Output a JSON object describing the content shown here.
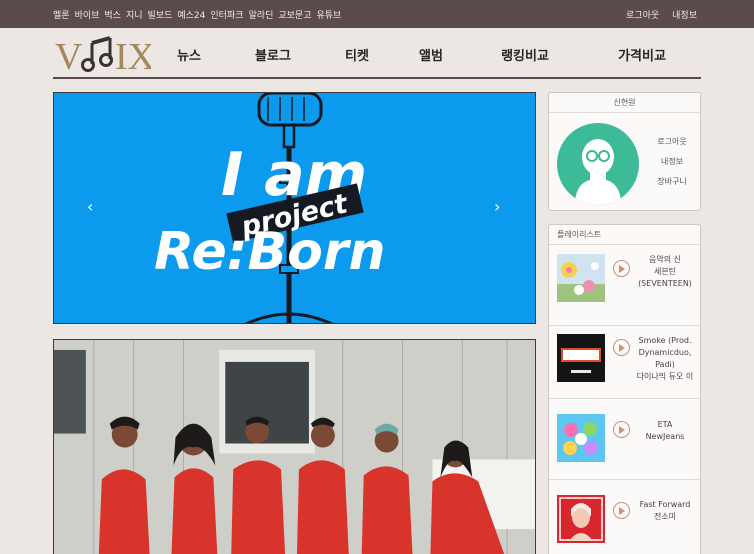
{
  "topbar": {
    "links": [
      "멜론",
      "바이브",
      "벅스",
      "지니",
      "빌보드",
      "예스24",
      "인터파크",
      "알라딘",
      "교보문고",
      "유튜브"
    ],
    "logout": "로그아웃",
    "myinfo": "내정보"
  },
  "logo": {
    "left": "V",
    "right": "IX"
  },
  "nav": [
    "뉴스",
    "블로그",
    "티켓",
    "앨범",
    "랭킹비교",
    "가격비교"
  ],
  "banner": {
    "line1": "I am",
    "line2": "project",
    "line3": "Re:Born",
    "prev": "‹",
    "next": "›",
    "background": "#0b9aee"
  },
  "profile": {
    "username": "신현원",
    "logout": "로그아웃",
    "myinfo": "내정보",
    "cart": "장바구니",
    "avatar_color": "#3dbb99"
  },
  "playlist": {
    "title": "플레이리스트",
    "items": [
      {
        "line1": "음악의 신",
        "line2": "세븐틴",
        "line3": "(SEVENTEEN)"
      },
      {
        "line1": "Smoke (Prod.",
        "line2": "Dynamicduo,",
        "line3": "Padi)",
        "line4": "다이나믹 듀오 이"
      },
      {
        "line1": "ETA",
        "line2": "NewJeans"
      },
      {
        "line1": "Fast Forward",
        "line2": "전소미"
      }
    ]
  },
  "colors": {
    "topbar": "#5a4c4a",
    "page": "#ece7e3",
    "accent": "#c9917a"
  }
}
